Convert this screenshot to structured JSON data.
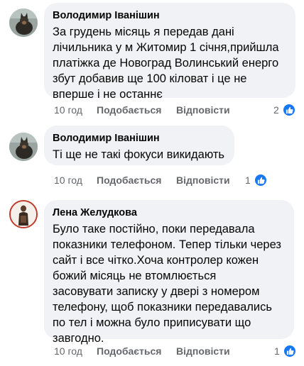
{
  "comments": [
    {
      "author": "Володимир Іванішин",
      "text": "За грудень місяць я передав дані\nлічильника у м Житомир 1 січня,прийшла\nплатіжка де Новоград Волинський енерго\nзбут добавив ще 100 кіловат і це не\nвперше і не останнє",
      "time": "10 год",
      "like_label": "Подобається",
      "reply_label": "Відповісти",
      "reactions": "2",
      "avatar_icon": "dog-avatar-icon"
    },
    {
      "author": "Володимир Іванішин",
      "text": "Ті ще не такі фокуси викидають",
      "time": "10 год",
      "like_label": "Подобається",
      "reply_label": "Відповісти",
      "reactions": "1",
      "avatar_icon": "dog-avatar-icon"
    },
    {
      "author": "Лена Желудкова",
      "text": "Було таке постійно, поки передавала\nпоказники телефоном. Тепер тільки через\nсайт і все чітко.Хоча контролер кожен\nбожий місяць не втомлюється\nзасовувати записку у двері з  номером\nтелефону, щоб показники передавались\nпо тел і можна було приписувати що\nзавгодно.",
      "time": "10 год",
      "like_label": "Подобається",
      "reply_label": "Відповісти",
      "reactions": "1",
      "avatar_icon": "person-avatar-icon"
    }
  ],
  "colors": {
    "bubble": "#f0f2f5",
    "meta_text": "#65676b",
    "like_badge": "#1877f2",
    "avatar_ring": "#c0392b"
  }
}
